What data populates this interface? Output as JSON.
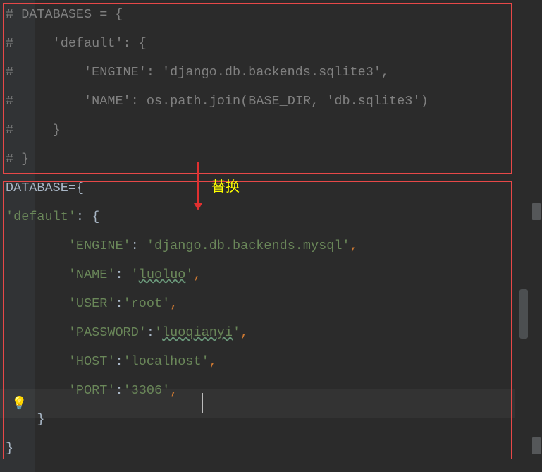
{
  "annotation": {
    "label": "替换"
  },
  "old": {
    "l1a": "# DATABASES = {",
    "l2a": "#     ",
    "l2b": "'default': {",
    "l3a": "#         ",
    "l3b": "'ENGINE': 'django.db.backends.sqlite3'",
    "l3c": ",",
    "l4a": "#         ",
    "l4b": "'NAME': ",
    "l4c": "os",
    "l4d": ".path.",
    "l4e": "join",
    "l4f": "(",
    "l4g": "BASE_DIR",
    "l4h": ", ",
    "l4i": "'db.sqlite3'",
    "l4j": ")",
    "l5a": "#     ",
    "l5b": "}",
    "l6a": "# ",
    "l6b": "}"
  },
  "new": {
    "l1_a": "DATABASE={",
    "l2_a": "'default'",
    "l2_b": ": {",
    "l3_a": "'ENGINE'",
    "l3_b": ": ",
    "l3_c": "'django.db.backends.mysql'",
    "l3_d": ",",
    "l4_a": "'NAME'",
    "l4_b": ": ",
    "l4_c": "'",
    "l4_d": "luoluo",
    "l4_e": "'",
    "l4_f": ",",
    "l5_a": "'USER'",
    "l5_b": ":",
    "l5_c": "'root'",
    "l5_d": ",",
    "l6_a": "'PASSWORD'",
    "l6_b": ":",
    "l6_c": "'",
    "l6_d": "luoqianyi",
    "l6_e": "'",
    "l6_f": ",",
    "l7_a": "'HOST'",
    "l7_b": ":",
    "l7_c": "'localhost'",
    "l7_d": ",",
    "l8_a": "'PORT'",
    "l8_b": ":",
    "l8_c": "'3306'",
    "l8_d": ",",
    "l9_a": "    }",
    "l10_a": "}"
  },
  "icons": {
    "bulb": "💡"
  }
}
